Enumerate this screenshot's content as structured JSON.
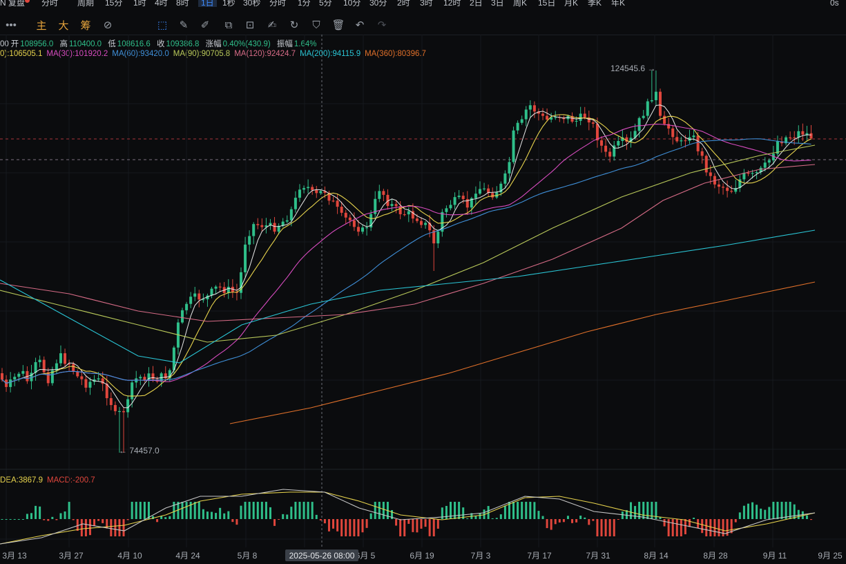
{
  "toolbar_top": {
    "items": [
      "N",
      "复盘",
      "分时",
      "周期",
      "15分",
      "1时",
      "4时",
      "8时",
      "1日",
      "1秒",
      "30秒",
      "分时",
      "1分",
      "5分",
      "10分",
      "30分",
      "2时",
      "3时",
      "12时",
      "2日",
      "3日",
      "周K",
      "15日",
      "月K",
      "季K",
      "年K"
    ],
    "active": "1日",
    "right_text": "0s"
  },
  "toolbar_tools": {
    "more": "•••",
    "labels": [
      "主",
      "大",
      "筹"
    ],
    "icons": [
      "indicator-icon",
      "select-icon",
      "ruler-icon",
      "pen-icon",
      "candle-icon",
      "lock-icon",
      "note-icon",
      "brush-icon",
      "filter-icon",
      "trash-icon",
      "undo-icon",
      "redo-icon"
    ]
  },
  "ohlc_line": {
    "prefix": "00",
    "open_label": "开",
    "open": "108956.0",
    "high_label": "高",
    "high": "110400.0",
    "low_label": "低",
    "low": "108616.6",
    "close_label": "收",
    "close": "109386.8",
    "change_label": "涨幅",
    "change": "0.40%(430.9)",
    "amp_label": "振幅",
    "amp": "1.64%"
  },
  "ma_line": [
    {
      "text": "0):106505.1",
      "color": "#e8d44d"
    },
    {
      "text": "MA(30):101920.2",
      "color": "#d84cc0"
    },
    {
      "text": "MA(60):93420.0",
      "color": "#3f8fd8"
    },
    {
      "text": "MA(90):90705.8",
      "color": "#b9c95a"
    },
    {
      "text": "MA(120):92424.7",
      "color": "#d66b86"
    },
    {
      "text": "MA(200):94115.9",
      "color": "#2ac6d6"
    },
    {
      "text": "MA(360):80396.7",
      "color": "#e0702a"
    }
  ],
  "macd_line": [
    {
      "text": "DEA:3867.9",
      "color": "#e8d44d"
    },
    {
      "text": "MACD:-200.7",
      "color": "#e0463c"
    }
  ],
  "annotations": {
    "high_label": "124545.6",
    "low_label": "74457.0"
  },
  "crosshair_label": "2025-05-26 08:00",
  "x_labels": [
    "3月 13",
    "3月 27",
    "4月 10",
    "4月 24",
    "5月 8",
    "6月 5",
    "6月 19",
    "7月 3",
    "7月 17",
    "7月 31",
    "8月 14",
    "8月 28",
    "9月 11",
    "9月 25"
  ],
  "colors": {
    "up": "#2fbf8a",
    "down": "#e0463c",
    "background": "#0b0c0e"
  },
  "chart_data": {
    "type": "candlestick",
    "price_high": 124545.6,
    "price_low": 74457.0,
    "ma_series": [
      "MA(30)",
      "MA(60)",
      "MA(90)",
      "MA(120)",
      "MA(200)",
      "MA(360)"
    ]
  }
}
